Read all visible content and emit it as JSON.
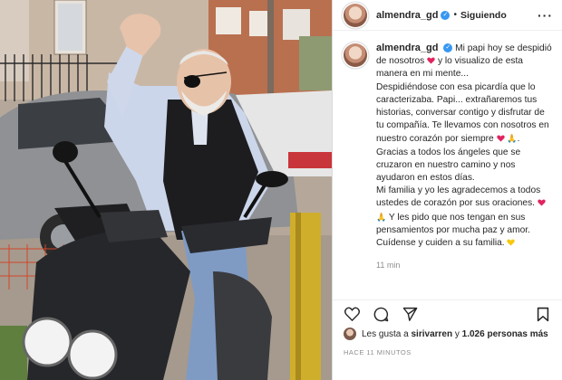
{
  "post": {
    "username": "almendra_gd",
    "follow_status": "Siguiendo",
    "separator": "•",
    "more_glyph": "···",
    "caption_lines": [
      "Mi papi hoy se",
      "despidió de nosotros",
      "y lo visualizo",
      "de esta manera en mi mente...",
      "Despidiéndose con esa picardía que lo",
      "caracterizaba. Papi... extrañaremos tus",
      "historias, conversar contigo y disfrutar",
      "de tu compañía. Te llevamos con",
      "nosotros en nuestro corazón por",
      "siempre",
      "Gracias a todos los",
      "ángeles que se cruzaron en nuestro",
      "camino y nos ayudaron en estos días.",
      "Mi familia y yo les agradecemos a",
      "todos ustedes de corazón por sus",
      "oraciones.",
      "Y les pido que nos",
      "tengan en sus pensamientos por",
      "mucha paz y amor. Cuídense y cuiden",
      "a su familia."
    ],
    "caption_time": "11 min",
    "likes_prefix": "Les gusta a",
    "likes_user": "sirivarren",
    "likes_joiner": "y",
    "likes_count": "1.026 personas más",
    "posted_ago": "HACE 11 MINUTOS"
  },
  "icons": {
    "verified": "verified-badge-icon",
    "like": "heart-outline-icon",
    "comment": "comment-bubble-icon",
    "share": "paper-plane-icon",
    "save": "bookmark-icon"
  },
  "colors": {
    "verified": "#3897f0",
    "heart_emoji": "#e0245e",
    "muted_text": "#8e8e8e"
  }
}
